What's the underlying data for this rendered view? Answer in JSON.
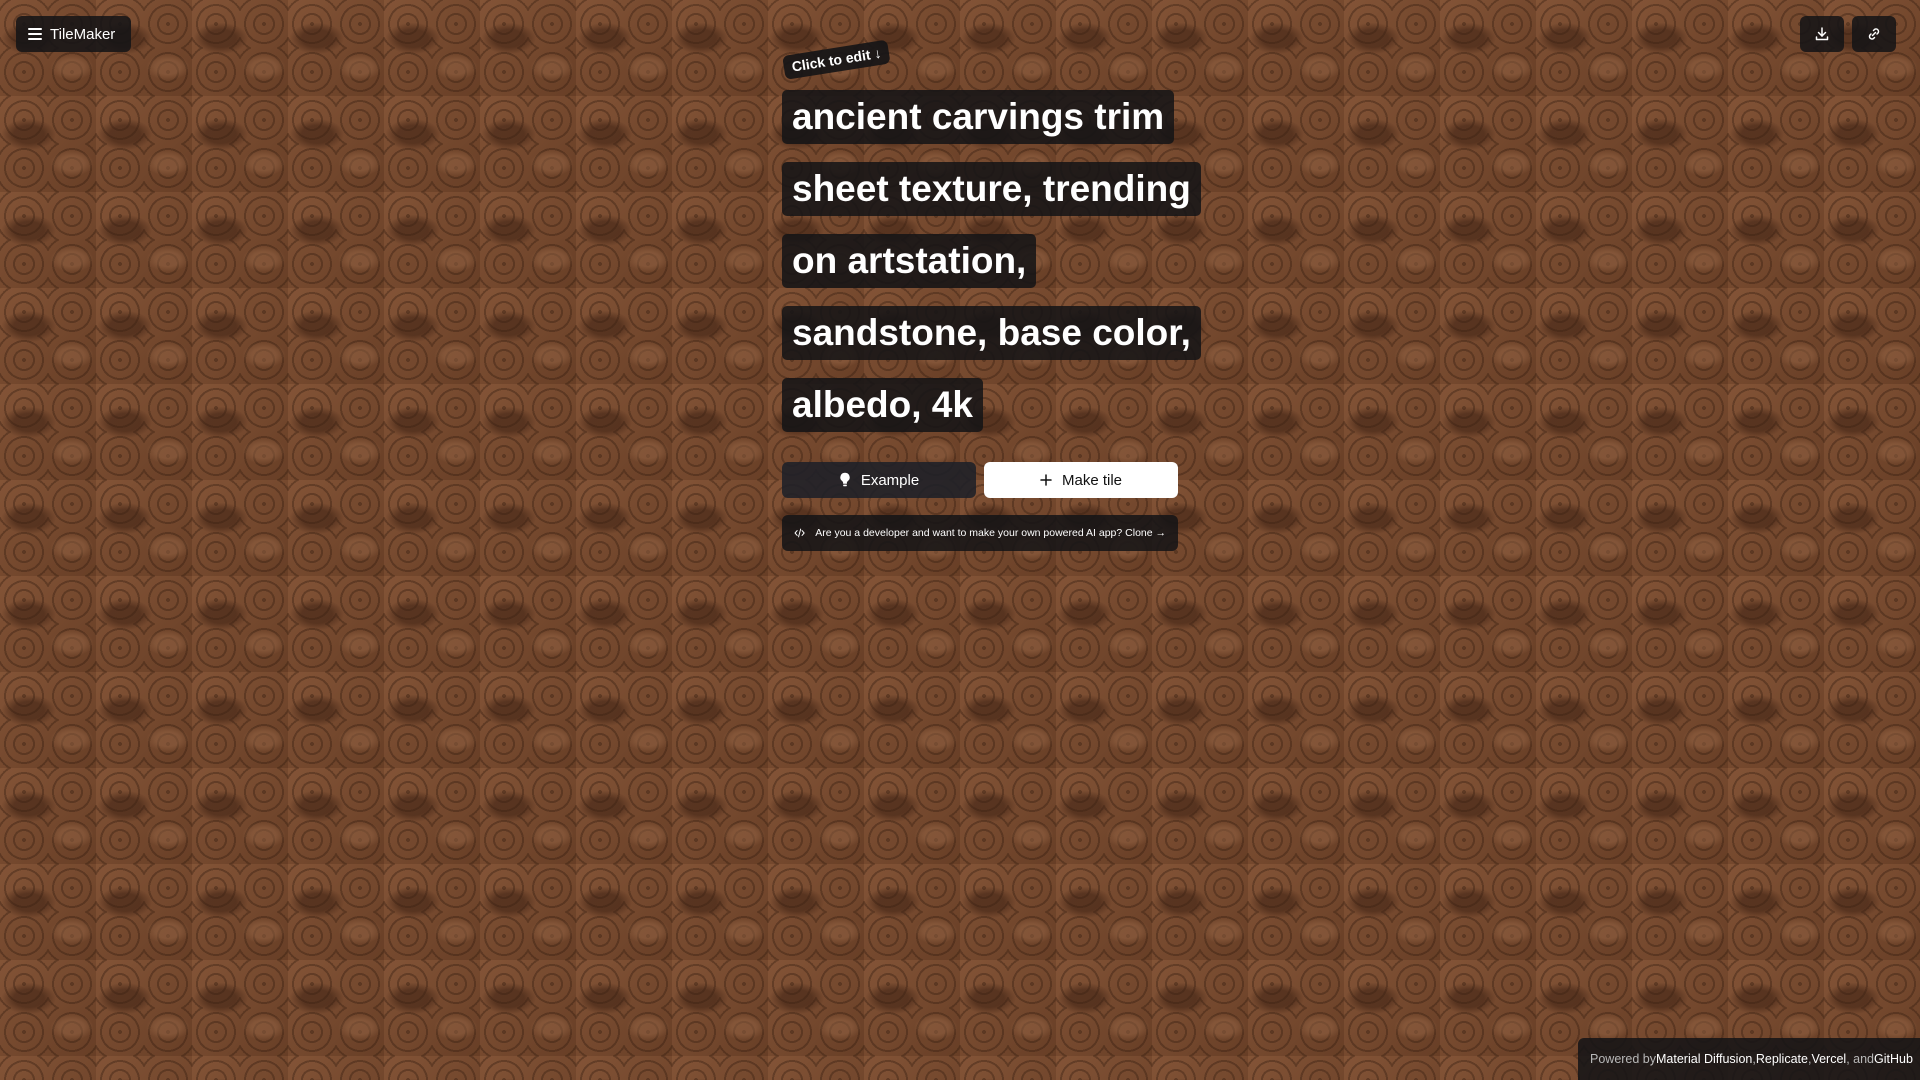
{
  "app": {
    "name": "TileMaker"
  },
  "hint": {
    "click_to_edit": "Click to edit ↓"
  },
  "prompt": {
    "lines": [
      "ancient carvings trim",
      "sheet texture, trending",
      "on artstation,",
      "sandstone, base color,",
      "albedo, 4k"
    ]
  },
  "actions": {
    "example_label": "Example",
    "make_tile_label": "Make tile"
  },
  "developer_banner": {
    "text": "Are you a developer and want to make your own powered AI app? Clone →"
  },
  "footer": {
    "prefix": "Powered by ",
    "material_diffusion": "Material Diffusion",
    "sep1": ", ",
    "replicate": "Replicate",
    "sep2": ", ",
    "vercel": "Vercel",
    "sep3": ", and ",
    "github": "GitHub"
  },
  "icons": {
    "menu": "menu-icon",
    "download": "download-icon",
    "link": "link-icon",
    "lightbulb": "lightbulb-icon",
    "plus": "plus-icon",
    "code": "code-icon"
  },
  "colors": {
    "panel": "#141416",
    "primary_button": "#ffffff",
    "background_texture": "#7a4c30"
  }
}
